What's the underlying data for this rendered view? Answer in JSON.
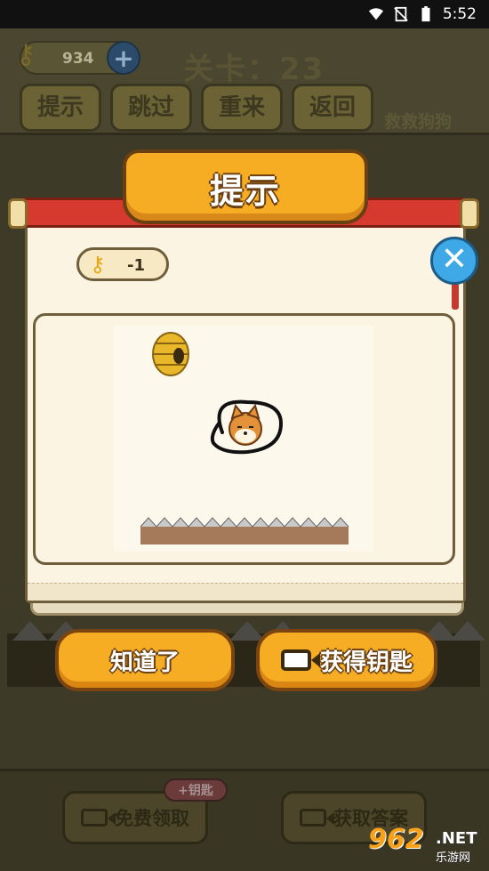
{
  "status_bar": {
    "time": "5:52"
  },
  "game": {
    "key_count": "934",
    "plus_label": "+",
    "level_label": "关卡：23",
    "buttons": [
      "提示",
      "跳过",
      "重来",
      "返回"
    ],
    "game_name": "救救狗狗",
    "bottom": {
      "free_label": "免费领取",
      "plus_key_badge": "+钥匙",
      "answer_label": "获取答案"
    }
  },
  "dialog": {
    "title": "提示",
    "cost": "-1",
    "close_label": "✕",
    "confirm_label": "知道了",
    "get_key_label": "获得钥匙"
  },
  "watermark": {
    "number": "962",
    "tld": ".NET",
    "site": "乐游网"
  },
  "colors": {
    "accent": "#f6ad24",
    "close_blue": "#3fa9e8",
    "scroll_red": "#d63a2e"
  },
  "icons": [
    "key-icon",
    "close-icon",
    "video-camera-icon",
    "beehive-icon",
    "shiba-dog-icon",
    "spikes-icon"
  ]
}
